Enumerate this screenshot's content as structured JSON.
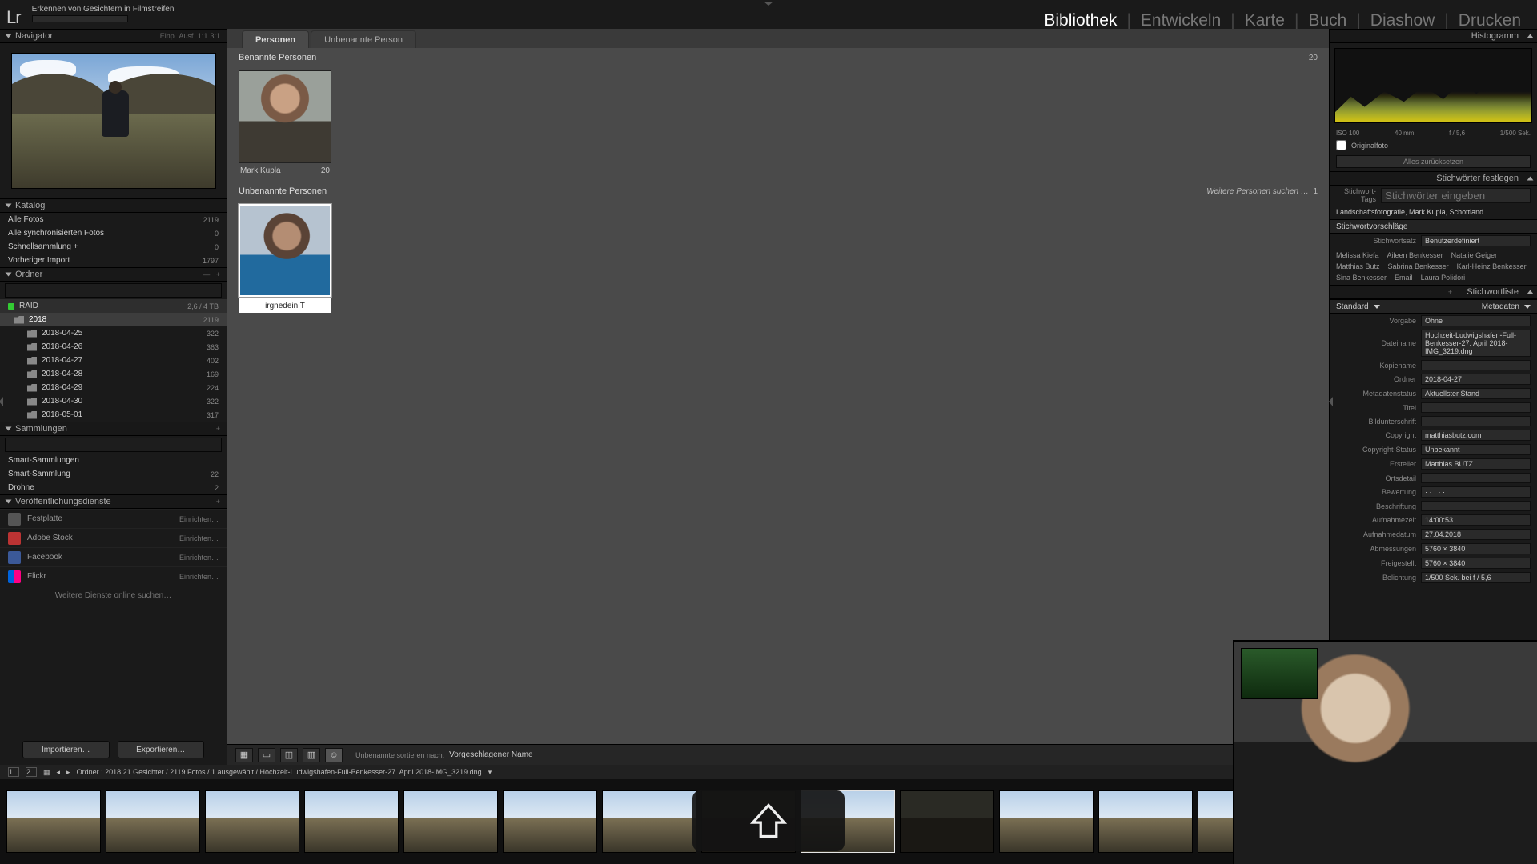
{
  "identity_title": "Erkennen von Gesichtern in Filmstreifen",
  "modules": {
    "items": [
      "Bibliothek",
      "Entwickeln",
      "Karte",
      "Buch",
      "Diashow",
      "Drucken"
    ],
    "active": 0
  },
  "navigator": {
    "title": "Navigator",
    "fit": "Einp.",
    "fill": "Ausf.",
    "r1": "1:1",
    "r2": "3:1"
  },
  "katalog": {
    "title": "Katalog",
    "rows": [
      {
        "label": "Alle Fotos",
        "count": "2119"
      },
      {
        "label": "Alle synchronisierten Fotos",
        "count": "0"
      },
      {
        "label": "Schnellsammlung  +",
        "count": "0"
      },
      {
        "label": "Vorheriger Import",
        "count": "1797"
      }
    ]
  },
  "ordner": {
    "title": "Ordner",
    "volume_name": "RAID",
    "volume_info": "2,6 / 4 TB",
    "rows": [
      {
        "label": "2018",
        "count": "2119",
        "sel": true,
        "depth": 0
      },
      {
        "label": "2018-04-25",
        "count": "322",
        "depth": 1
      },
      {
        "label": "2018-04-26",
        "count": "363",
        "depth": 1
      },
      {
        "label": "2018-04-27",
        "count": "402",
        "depth": 1
      },
      {
        "label": "2018-04-28",
        "count": "169",
        "depth": 1
      },
      {
        "label": "2018-04-29",
        "count": "224",
        "depth": 1
      },
      {
        "label": "2018-04-30",
        "count": "322",
        "depth": 1
      },
      {
        "label": "2018-05-01",
        "count": "317",
        "depth": 1
      }
    ]
  },
  "sammlungen": {
    "title": "Sammlungen",
    "rows": [
      {
        "label": "Smart-Sammlungen",
        "count": ""
      },
      {
        "label": "Smart-Sammlung",
        "count": "22"
      },
      {
        "label": "Drohne",
        "count": "2"
      }
    ]
  },
  "publish": {
    "title": "Veröffentlichungsdienste",
    "rows": [
      {
        "label": "Festplatte",
        "icon": "#555"
      },
      {
        "label": "Adobe Stock",
        "icon": "#b33"
      },
      {
        "label": "Facebook",
        "icon": "#3b5998"
      },
      {
        "label": "Flickr",
        "icon": "linear-gradient(90deg,#0063dc 50%,#ff0084 50%)"
      }
    ],
    "setup": "Einrichten…",
    "more": "Weitere Dienste online suchen…"
  },
  "left_buttons": {
    "import": "Importieren…",
    "export": "Exportieren…"
  },
  "center": {
    "tabs": {
      "main": "Personen",
      "sub": "Unbenannte Person"
    },
    "named_header": "Benannte Personen",
    "named_count": "20",
    "named": {
      "name": "Mark Kupla",
      "count": "20"
    },
    "unnamed_header": "Unbenannte Personen",
    "unnamed_more": "Weitere Personen suchen …",
    "unnamed_more_count": "1",
    "unnamed_input": "irgnedein T",
    "sort_label": "Unbenannte sortieren nach:",
    "sort_value": "Vorgeschlagener Name"
  },
  "infobar": "Ordner : 2018   21 Gesichter / 2119 Fotos / 1 ausgewählt / Hochzeit-Ludwigshafen-Full-Benkesser-27. April 2018-IMG_3219.dng",
  "right": {
    "histogram": "Histogramm",
    "hinfo": {
      "iso": "ISO 100",
      "focal": "40 mm",
      "ap": "f / 5,6",
      "sh": "1/500 Sek."
    },
    "orig": "Originalfoto",
    "reset": "Alles zurücksetzen",
    "kw_set": "Stichwörter festlegen",
    "kw_tags_label": "Stichwort-Tags",
    "kw_tags_ph": "Stichwörter eingeben",
    "kw_existing": "Landschaftsfotografie, Mark Kupla, Schottland",
    "kw_sugg_title": "Stichwortvorschläge",
    "kw_set_label": "Stichwortsatz",
    "kw_set_value": "Benutzerdefiniert",
    "suggestions": [
      "Melissa Kiefa",
      "Aileen Benkesser",
      "Natalie Geiger",
      "Matthias Butz",
      "Sabrina Benkesser",
      "Karl-Heinz Benkesser",
      "Sina Benkesser",
      "Email",
      "Laura Polidori"
    ],
    "kw_list": "Stichwortliste",
    "meta_preset_label": "Standard",
    "metadata": "Metadaten",
    "meta": [
      {
        "k": "Vorgabe",
        "v": "Ohne"
      },
      {
        "k": "Dateiname",
        "v": "Hochzeit-Ludwigshafen-Full-Benkesser-27. April 2018-IMG_3219.dng"
      },
      {
        "k": "Kopiename",
        "v": ""
      },
      {
        "k": "Ordner",
        "v": "2018-04-27"
      },
      {
        "k": "Metadatenstatus",
        "v": "Aktuellster Stand"
      },
      {
        "k": "Titel",
        "v": ""
      },
      {
        "k": "Bildunterschrift",
        "v": ""
      },
      {
        "k": "Copyright",
        "v": "matthiasbutz.com"
      },
      {
        "k": "Copyright-Status",
        "v": "Unbekannt"
      },
      {
        "k": "Ersteller",
        "v": "Matthias BUTZ"
      },
      {
        "k": "Ortsdetail",
        "v": ""
      },
      {
        "k": "Bewertung",
        "v": "·  ·  ·  ·  ·"
      },
      {
        "k": "Beschriftung",
        "v": ""
      },
      {
        "k": "Aufnahmezeit",
        "v": "14:00:53"
      },
      {
        "k": "Aufnahmedatum",
        "v": "27.04.2018"
      },
      {
        "k": "Abmessungen",
        "v": "5760 × 3840"
      },
      {
        "k": "Freigestellt",
        "v": "5760 × 3840"
      },
      {
        "k": "Belichtung",
        "v": "1/500 Sek. bei f / 5,6"
      }
    ]
  }
}
